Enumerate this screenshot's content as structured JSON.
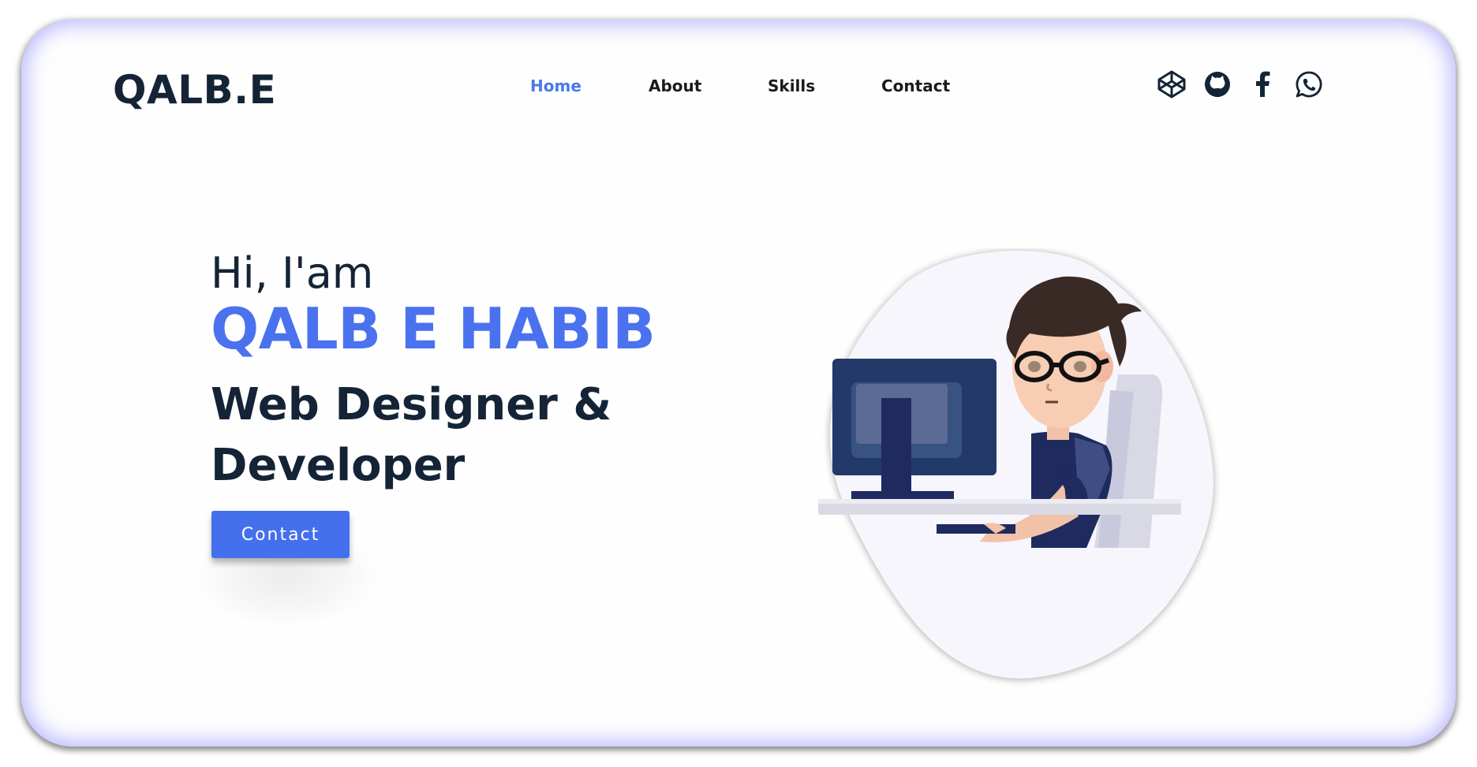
{
  "brand": {
    "logo_text": "QALB.E"
  },
  "nav": {
    "items": [
      {
        "label": "Home",
        "active": true
      },
      {
        "label": "About",
        "active": false
      },
      {
        "label": "Skills",
        "active": false
      },
      {
        "label": "Contact",
        "active": false
      }
    ]
  },
  "socials": [
    {
      "icon": "codepen-icon"
    },
    {
      "icon": "github-icon"
    },
    {
      "icon": "facebook-icon"
    },
    {
      "icon": "whatsapp-icon"
    }
  ],
  "hero": {
    "greeting": "Hi, I'am",
    "name": "QALB E HABIB",
    "role": "Web Designer & Developer",
    "contact_label": "Contact"
  },
  "colors": {
    "accent": "#4a72ef",
    "text_dark": "#142436",
    "frame_glow": "#8480ff",
    "blob_fill": "#f6f6fc"
  }
}
